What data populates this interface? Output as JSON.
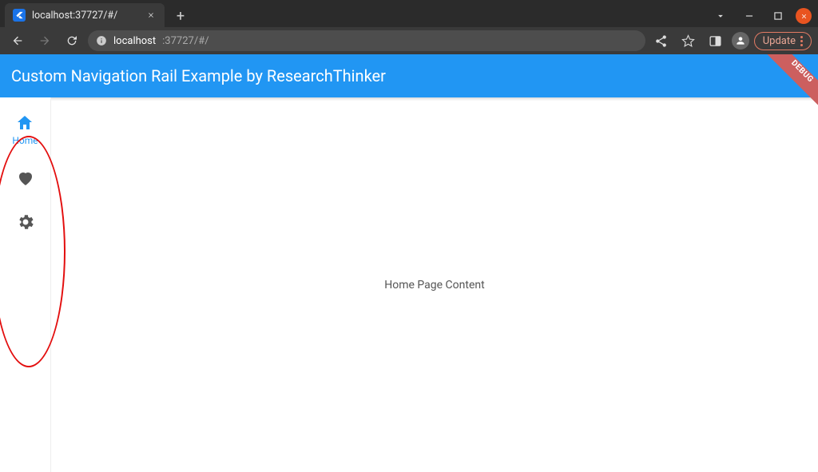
{
  "browser": {
    "tab": {
      "title": "localhost:37727/#/"
    },
    "url_host": "localhost",
    "url_path": ":37727/#/",
    "update_label": "Update"
  },
  "appbar": {
    "title": "Custom Navigation Rail Example by ResearchThinker",
    "debug": "DEBUG"
  },
  "rail": {
    "items": [
      {
        "label": "Home"
      },
      {
        "label": ""
      },
      {
        "label": ""
      }
    ]
  },
  "content": {
    "text": "Home Page Content"
  }
}
